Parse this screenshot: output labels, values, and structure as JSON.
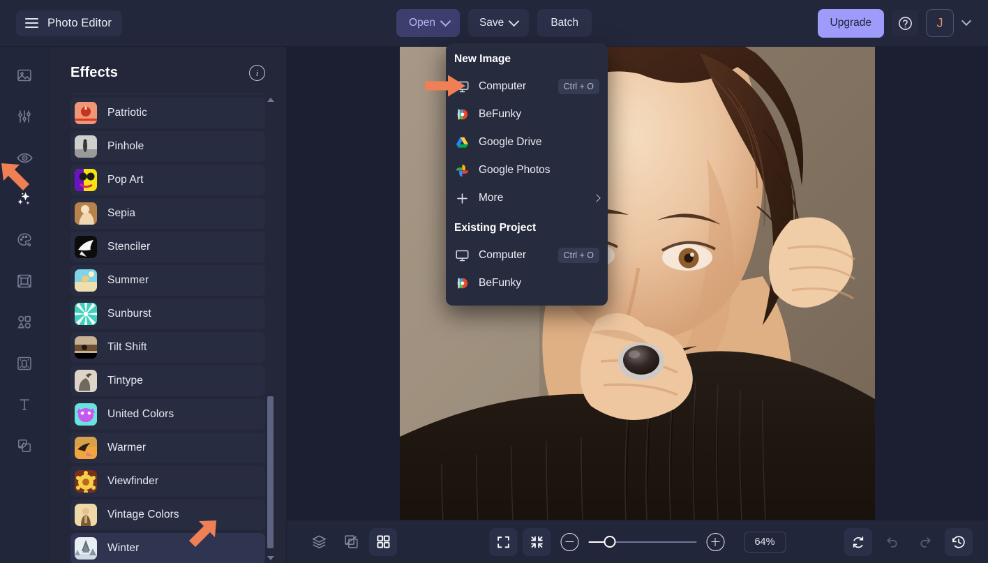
{
  "app": {
    "title": "Photo Editor",
    "accent_purple": "#9f9bfa",
    "accent_orange": "#ef8055",
    "panel_bg": "#232739",
    "canvas_bg": "#1b1f31"
  },
  "header": {
    "menu_icon": "hamburger-icon",
    "open_label": "Open",
    "save_label": "Save",
    "batch_label": "Batch",
    "upgrade_label": "Upgrade",
    "help_icon": "question-mark-icon",
    "avatar_initial": "J",
    "account_caret_icon": "chevron-down-icon"
  },
  "rail": {
    "items": [
      {
        "name": "image",
        "icon": "image-icon",
        "active": false
      },
      {
        "name": "adjust",
        "icon": "sliders-icon",
        "active": false
      },
      {
        "name": "retouch",
        "icon": "eye-icon",
        "active": false
      },
      {
        "name": "effects",
        "icon": "sparkles-icon",
        "active": true
      },
      {
        "name": "artsy",
        "icon": "palette-icon",
        "active": false
      },
      {
        "name": "frames",
        "icon": "frame-icon",
        "active": false
      },
      {
        "name": "graphics",
        "icon": "shapes-icon",
        "active": false
      },
      {
        "name": "textures",
        "icon": "texture-icon",
        "active": false
      },
      {
        "name": "text",
        "icon": "text-icon",
        "active": false
      },
      {
        "name": "overlays",
        "icon": "layers-icon",
        "active": false
      }
    ]
  },
  "panel": {
    "title": "Effects",
    "info_icon": "info-icon",
    "scroll_up_icon": "triangle-up-icon",
    "scroll_down_icon": "triangle-down-icon",
    "effects": [
      {
        "label": "Patriotic",
        "selected": false
      },
      {
        "label": "Pinhole",
        "selected": false
      },
      {
        "label": "Pop Art",
        "selected": false
      },
      {
        "label": "Sepia",
        "selected": false
      },
      {
        "label": "Stenciler",
        "selected": false
      },
      {
        "label": "Summer",
        "selected": false
      },
      {
        "label": "Sunburst",
        "selected": false
      },
      {
        "label": "Tilt Shift",
        "selected": false
      },
      {
        "label": "Tintype",
        "selected": false
      },
      {
        "label": "United Colors",
        "selected": false
      },
      {
        "label": "Warmer",
        "selected": false
      },
      {
        "label": "Viewfinder",
        "selected": false
      },
      {
        "label": "Vintage Colors",
        "selected": false
      },
      {
        "label": "Winter",
        "selected": true
      }
    ]
  },
  "open_menu": {
    "section_new": "New Image",
    "section_existing": "Existing Project",
    "new_items": [
      {
        "label": "Computer",
        "icon": "monitor-icon",
        "shortcut": "Ctrl + O"
      },
      {
        "label": "BeFunky",
        "icon": "befunky-icon",
        "shortcut": ""
      },
      {
        "label": "Google Drive",
        "icon": "google-drive-icon",
        "shortcut": ""
      },
      {
        "label": "Google Photos",
        "icon": "google-photos-icon",
        "shortcut": ""
      },
      {
        "label": "More",
        "icon": "plus-icon",
        "shortcut": "",
        "submenu": true
      }
    ],
    "existing_items": [
      {
        "label": "Computer",
        "icon": "monitor-icon",
        "shortcut": "Ctrl + O"
      },
      {
        "label": "BeFunky",
        "icon": "befunky-icon",
        "shortcut": ""
      }
    ]
  },
  "bottombar": {
    "left_icons": [
      {
        "name": "layers-panel",
        "icon": "stack-icon",
        "active": false
      },
      {
        "name": "transform",
        "icon": "transform-icon",
        "active": false
      },
      {
        "name": "grid-view",
        "icon": "grid-icon",
        "active": true
      }
    ],
    "fit_icon": "expand-frame-icon",
    "shrink_icon": "collapse-arrows-icon",
    "zoom_out_icon": "minus-circle-icon",
    "zoom_in_icon": "plus-circle-icon",
    "zoom_value": "64%",
    "zoom_percent": 64,
    "right_icons": [
      {
        "name": "reset",
        "icon": "refresh-icon",
        "enabled": true
      },
      {
        "name": "undo",
        "icon": "undo-icon",
        "enabled": false
      },
      {
        "name": "redo",
        "icon": "redo-icon",
        "enabled": false
      },
      {
        "name": "history",
        "icon": "clock-history-icon",
        "enabled": true
      }
    ]
  },
  "annotations": [
    {
      "name": "arrow-pointing-to-computer-menu-item",
      "color": "#ef8055"
    },
    {
      "name": "arrow-pointing-to-effects-rail-icon",
      "color": "#ef8055"
    },
    {
      "name": "arrow-pointing-to-winter-effect",
      "color": "#ef8055"
    }
  ],
  "canvas": {
    "photo_description": "portrait-photo-woman-black-turtleneck"
  }
}
